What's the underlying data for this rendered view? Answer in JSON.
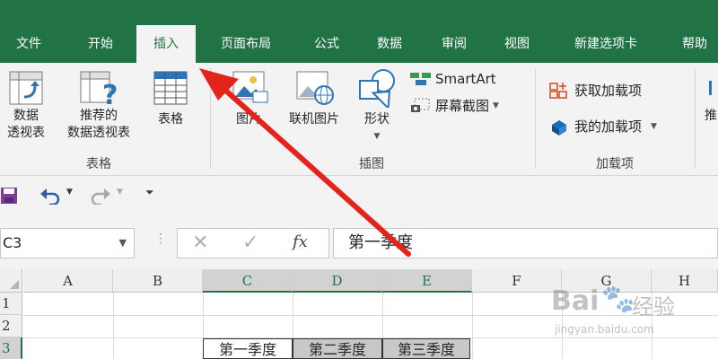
{
  "tabs": [
    "文件",
    "开始",
    "插入",
    "页面布局",
    "公式",
    "数据",
    "审阅",
    "视图",
    "新建选项卡",
    "帮助"
  ],
  "active_tab": "插入",
  "ribbon": {
    "pivot_table": [
      "数据",
      "透视表"
    ],
    "recommended_pivot": [
      "推荐的",
      "数据透视表"
    ],
    "table": "表格",
    "group_tables": "表格",
    "picture": "图片",
    "online_picture": "联机图片",
    "shapes": "形状",
    "smartart": "SmartArt",
    "screenshot": "屏幕截图",
    "group_illustrations": "插图",
    "get_addins": "获取加载项",
    "my_addins": "我的加载项",
    "group_addins": "加载项",
    "recommended_partial": "推"
  },
  "name_box": "C3",
  "formula_bar": "第一季度",
  "fx_label": "fx",
  "columns": [
    "A",
    "B",
    "C",
    "D",
    "E",
    "F",
    "G",
    "H"
  ],
  "selected_columns": [
    "C",
    "D",
    "E"
  ],
  "rows": [
    "1",
    "2",
    "3"
  ],
  "row3_cells": [
    "第一季度",
    "第二季度",
    "第三季度"
  ],
  "watermark": {
    "brand": "Bai",
    "brand2": "经验",
    "url": "jingyan.baidu.com"
  },
  "colors": {
    "excel_green": "#217346",
    "arrow_red": "#e5231d"
  }
}
